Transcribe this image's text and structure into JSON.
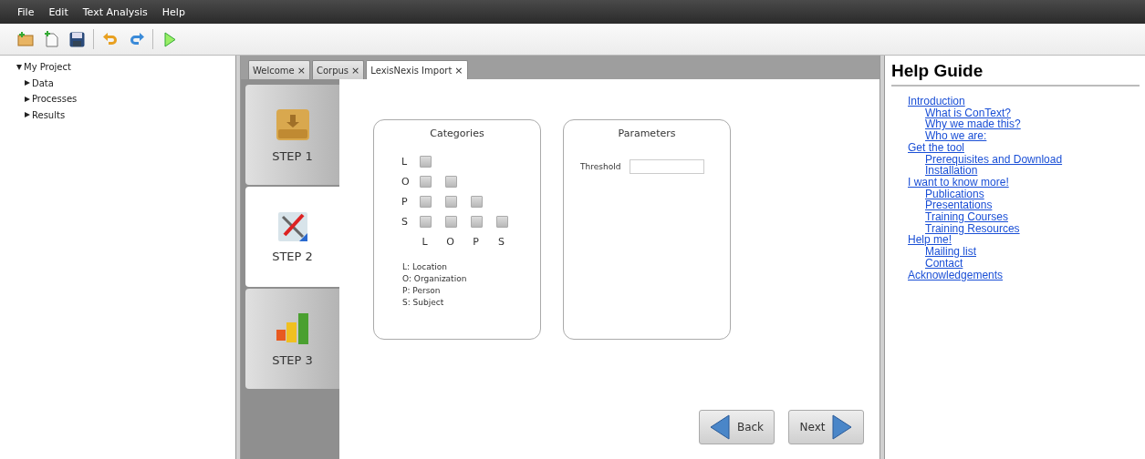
{
  "menu": [
    "File",
    "Edit",
    "Text Analysis",
    "Help"
  ],
  "toolbar": [
    {
      "kind": "new-folder"
    },
    {
      "kind": "new-file"
    },
    {
      "kind": "save"
    },
    {
      "kind": "sep"
    },
    {
      "kind": "undo"
    },
    {
      "kind": "redo"
    },
    {
      "kind": "sep"
    },
    {
      "kind": "run"
    }
  ],
  "tree": {
    "label": "My Project",
    "expanded": true,
    "children": [
      {
        "label": "Data",
        "expanded": false
      },
      {
        "label": "Processes",
        "expanded": false
      },
      {
        "label": "Results",
        "expanded": false
      }
    ]
  },
  "tabs": [
    {
      "label": "Welcome",
      "close": "×",
      "selected": false
    },
    {
      "label": "Corpus",
      "close": "×",
      "selected": false
    },
    {
      "label": "LexisNexis Import",
      "close": "×",
      "selected": true
    }
  ],
  "steps": [
    {
      "label": "STEP 1",
      "kind": "folder",
      "selected": false
    },
    {
      "label": "STEP 2",
      "kind": "tools",
      "selected": true
    },
    {
      "label": "STEP 3",
      "kind": "chart",
      "selected": false
    }
  ],
  "categories": {
    "title": "Categories",
    "rows": [
      {
        "label": "L",
        "cells": [
          {
            "checked": false
          }
        ]
      },
      {
        "label": "O",
        "cells": [
          {
            "checked": false
          },
          {
            "checked": false
          }
        ]
      },
      {
        "label": "P",
        "cells": [
          {
            "checked": false
          },
          {
            "checked": false
          },
          {
            "checked": false
          }
        ]
      },
      {
        "label": "S",
        "cells": [
          {
            "checked": false
          },
          {
            "checked": false
          },
          {
            "checked": false
          },
          {
            "checked": false
          }
        ]
      }
    ],
    "columns": [
      "L",
      "O",
      "P",
      "S"
    ],
    "legend": [
      "L: Location",
      "O: Organization",
      "P: Person",
      "S: Subject"
    ]
  },
  "parameters": {
    "title": "Parameters",
    "fields": [
      {
        "label": "Threshold"
      }
    ]
  },
  "buttons": [
    {
      "label": "Back",
      "kind": "back"
    },
    {
      "label": "Next",
      "kind": "next"
    }
  ],
  "help": {
    "title": "Help Guide",
    "links": [
      {
        "label": "Introduction",
        "children": [
          {
            "label": "What is ConText?"
          },
          {
            "label": "Why we made this?"
          },
          {
            "label": "Who we are:"
          }
        ]
      },
      {
        "label": "Get the tool",
        "children": [
          {
            "label": "Prerequisites and Download"
          },
          {
            "label": "Installation"
          }
        ]
      },
      {
        "label": "I want to know more!",
        "children": [
          {
            "label": "Publications"
          },
          {
            "label": "Presentations"
          },
          {
            "label": "Training Courses"
          },
          {
            "label": "Training Resources"
          }
        ]
      },
      {
        "label": "Help me!",
        "children": [
          {
            "label": "Mailing list"
          },
          {
            "label": "Contact"
          }
        ]
      },
      {
        "label": "Acknowledgements"
      }
    ]
  }
}
